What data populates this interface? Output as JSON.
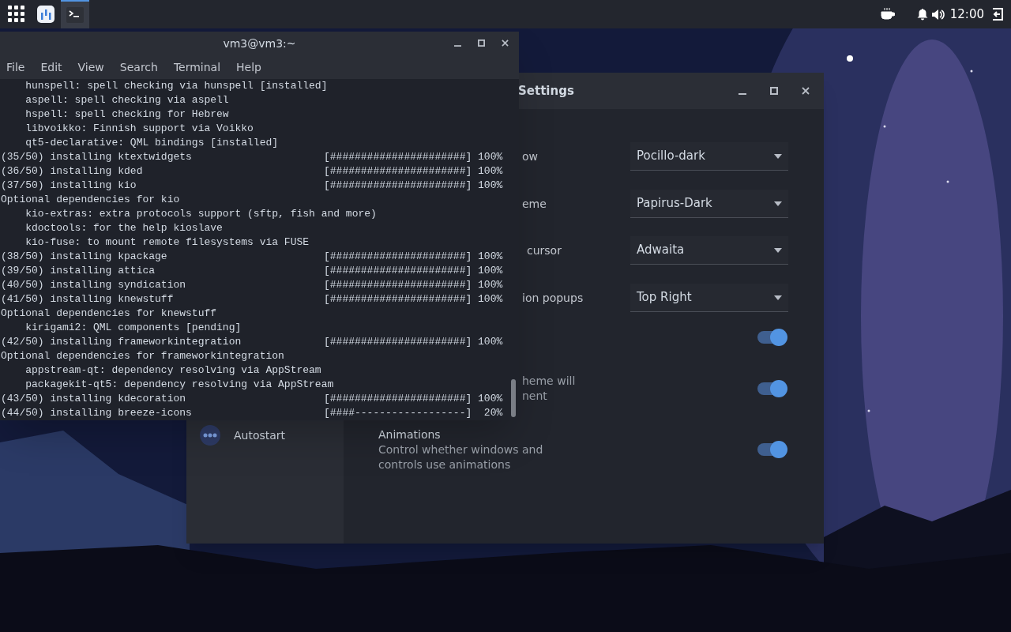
{
  "top_bar": {
    "clock": "12:00",
    "launchers": [
      {
        "kind": "apps",
        "selected": false
      },
      {
        "kind": "app",
        "selected": false
      },
      {
        "kind": "terminal",
        "selected": true
      }
    ]
  },
  "settings_window": {
    "title": "Settings",
    "sidebar": {
      "items": [
        {
          "label": "Autostart",
          "selected": false
        }
      ]
    },
    "rows": [
      {
        "kind": "dropdown",
        "label": "ow",
        "value": "Pocillo-dark"
      },
      {
        "kind": "dropdown",
        "label": "eme",
        "value": "Papirus-Dark"
      },
      {
        "kind": "dropdown",
        "label": "cursor",
        "value": "Adwaita"
      },
      {
        "kind": "dropdown",
        "label": "ion popups",
        "value": "Top Right"
      },
      {
        "kind": "toggle",
        "on": true
      },
      {
        "kind": "toggle",
        "description_lines": [
          "heme will",
          "nent"
        ],
        "on": true
      },
      {
        "kind": "toggle",
        "title": "Animations",
        "description": "Control whether windows and controls use animations",
        "on": true
      }
    ]
  },
  "terminal_window": {
    "title": "vm3@vm3:~",
    "menu": [
      "File",
      "Edit",
      "View",
      "Search",
      "Terminal",
      "Help"
    ],
    "lines": [
      {
        "kind": "text",
        "text": "    hunspell: spell checking via hunspell [installed]"
      },
      {
        "kind": "text",
        "text": "    aspell: spell checking via aspell"
      },
      {
        "kind": "text",
        "text": "    hspell: spell checking for Hebrew"
      },
      {
        "kind": "text",
        "text": "    libvoikko: Finnish support via Voikko"
      },
      {
        "kind": "text",
        "text": "    qt5-declarative: QML bindings [installed]"
      },
      {
        "kind": "progress",
        "text": "(35/50) installing ktextwidgets",
        "bar": "[######################] 100%"
      },
      {
        "kind": "progress",
        "text": "(36/50) installing kded",
        "bar": "[######################] 100%"
      },
      {
        "kind": "progress",
        "text": "(37/50) installing kio",
        "bar": "[######################] 100%"
      },
      {
        "kind": "text",
        "text": "Optional dependencies for kio"
      },
      {
        "kind": "text",
        "text": "    kio-extras: extra protocols support (sftp, fish and more)"
      },
      {
        "kind": "text",
        "text": "    kdoctools: for the help kioslave"
      },
      {
        "kind": "text",
        "text": "    kio-fuse: to mount remote filesystems via FUSE"
      },
      {
        "kind": "progress",
        "text": "(38/50) installing kpackage",
        "bar": "[######################] 100%"
      },
      {
        "kind": "progress",
        "text": "(39/50) installing attica",
        "bar": "[######################] 100%"
      },
      {
        "kind": "progress",
        "text": "(40/50) installing syndication",
        "bar": "[######################] 100%"
      },
      {
        "kind": "progress",
        "text": "(41/50) installing knewstuff",
        "bar": "[######################] 100%"
      },
      {
        "kind": "text",
        "text": "Optional dependencies for knewstuff"
      },
      {
        "kind": "text",
        "text": "    kirigami2: QML components [pending]"
      },
      {
        "kind": "progress",
        "text": "(42/50) installing frameworkintegration",
        "bar": "[######################] 100%"
      },
      {
        "kind": "text",
        "text": "Optional dependencies for frameworkintegration"
      },
      {
        "kind": "text",
        "text": "    appstream-qt: dependency resolving via AppStream"
      },
      {
        "kind": "text",
        "text": "    packagekit-qt5: dependency resolving via AppStream"
      },
      {
        "kind": "progress",
        "text": "(43/50) installing kdecoration",
        "bar": "[######################] 100%"
      },
      {
        "kind": "progress",
        "text": "(44/50) installing breeze-icons",
        "bar": "[####------------------]  20%"
      }
    ]
  }
}
